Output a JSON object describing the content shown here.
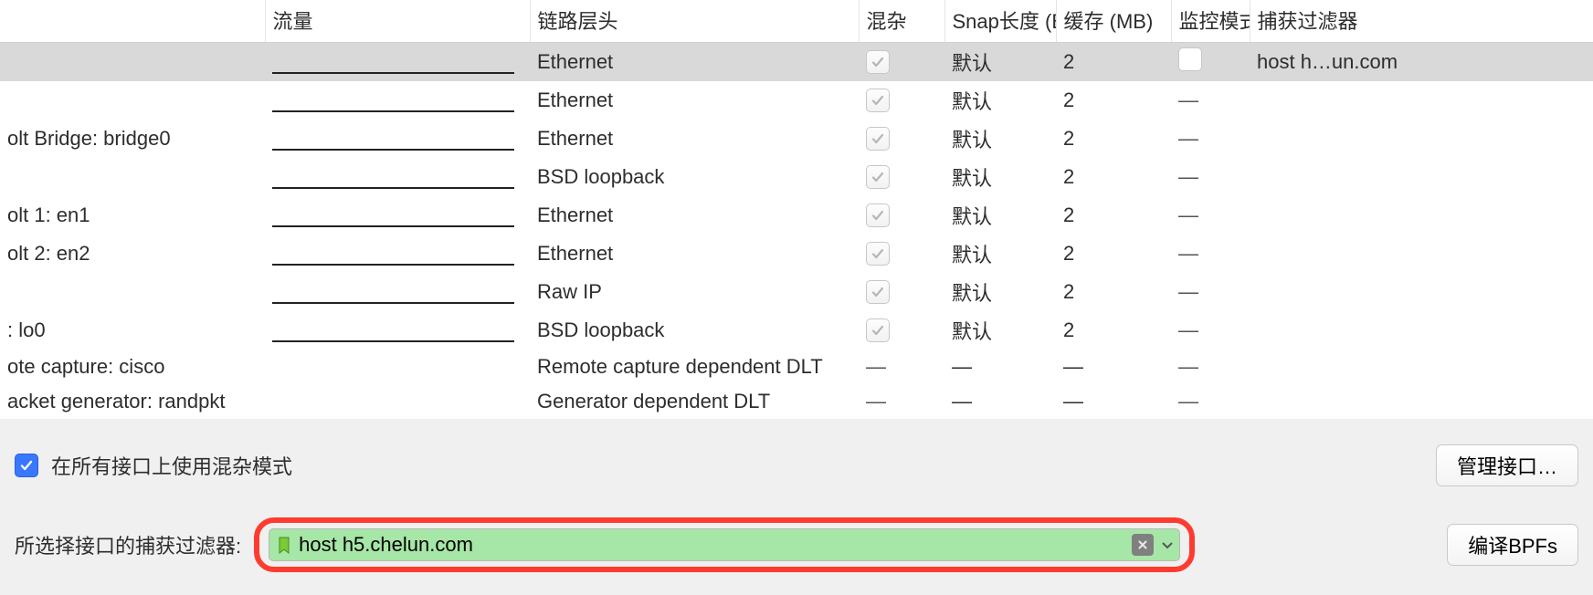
{
  "columns": {
    "interface": "",
    "traffic": "流量",
    "linklayer": "链路层头",
    "promisc": "混杂",
    "snaplen": "Snap长度 (B",
    "buffer": "缓存 (MB)",
    "monitor": "监控模式",
    "filter": "捕获过滤器"
  },
  "rows": [
    {
      "iface": "",
      "selected": true,
      "sparkline": true,
      "ll": "Ethernet",
      "promisc": "check",
      "snap": "默认",
      "buf": "2",
      "mon": "box",
      "filter": "host h…un.com"
    },
    {
      "iface": "",
      "sparkline": true,
      "ll": "Ethernet",
      "promisc": "check",
      "snap": "默认",
      "buf": "2",
      "mon": "dash",
      "filter": ""
    },
    {
      "iface": "olt Bridge: bridge0",
      "sparkline": true,
      "ll": "Ethernet",
      "promisc": "check",
      "snap": "默认",
      "buf": "2",
      "mon": "dash",
      "filter": ""
    },
    {
      "iface": "",
      "sparkline": true,
      "ll": "BSD loopback",
      "promisc": "check",
      "snap": "默认",
      "buf": "2",
      "mon": "dash",
      "filter": ""
    },
    {
      "iface": "olt 1: en1",
      "sparkline": true,
      "ll": "Ethernet",
      "promisc": "check",
      "snap": "默认",
      "buf": "2",
      "mon": "dash",
      "filter": ""
    },
    {
      "iface": "olt 2: en2",
      "sparkline": true,
      "ll": "Ethernet",
      "promisc": "check",
      "snap": "默认",
      "buf": "2",
      "mon": "dash",
      "filter": ""
    },
    {
      "iface": "",
      "sparkline": true,
      "ll": "Raw IP",
      "promisc": "check",
      "snap": "默认",
      "buf": "2",
      "mon": "dash",
      "filter": ""
    },
    {
      "iface": ": lo0",
      "sparkline": true,
      "ll": "BSD loopback",
      "promisc": "check",
      "snap": "默认",
      "buf": "2",
      "mon": "dash",
      "filter": ""
    },
    {
      "iface": "ote capture: cisco",
      "sparkline": false,
      "ll": "Remote capture dependent DLT",
      "promisc": "dash",
      "snap": "—",
      "buf": "—",
      "mon": "dash",
      "filter": ""
    },
    {
      "iface": "acket generator: randpkt",
      "sparkline": false,
      "ll": "Generator dependent DLT",
      "promisc": "dash",
      "snap": "—",
      "buf": "—",
      "mon": "dash",
      "filter": ""
    }
  ],
  "promisc_all": {
    "checked": true,
    "label": "在所有接口上使用混杂模式"
  },
  "manage_button": "管理接口…",
  "filter_label": "所选择接口的捕获过滤器:",
  "filter_value": "host h5.chelun.com",
  "compile_button": "编译BPFs",
  "dash": "—"
}
